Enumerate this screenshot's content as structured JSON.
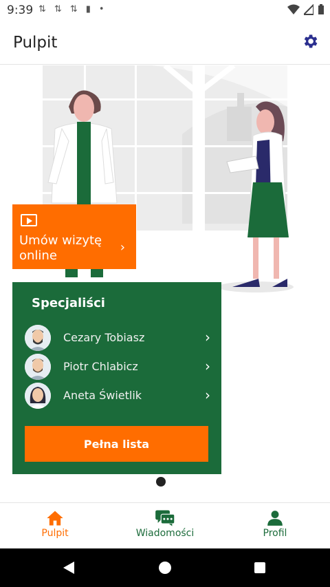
{
  "status": {
    "time": "9:39"
  },
  "app": {
    "title": "Pulpit"
  },
  "online_card": {
    "label": "Umów wizytę online"
  },
  "specialists": {
    "title": "Specjaliści",
    "items": [
      {
        "name": "Cezary Tobiasz"
      },
      {
        "name": "Piotr Chlabicz"
      },
      {
        "name": "Aneta Świetlik"
      }
    ],
    "full_list_label": "Pełna lista"
  },
  "bottom_nav": {
    "items": [
      {
        "label": "Pulpit",
        "icon": "home-icon",
        "active": true
      },
      {
        "label": "Wiadomości",
        "icon": "chat-icon",
        "active": false
      },
      {
        "label": "Profil",
        "icon": "person-icon",
        "active": false
      }
    ]
  },
  "colors": {
    "accent_orange": "#ff6d00",
    "card_green": "#1b6b3a",
    "nav_green": "#1b6b3a",
    "gear_blue": "#2b2f8f"
  }
}
